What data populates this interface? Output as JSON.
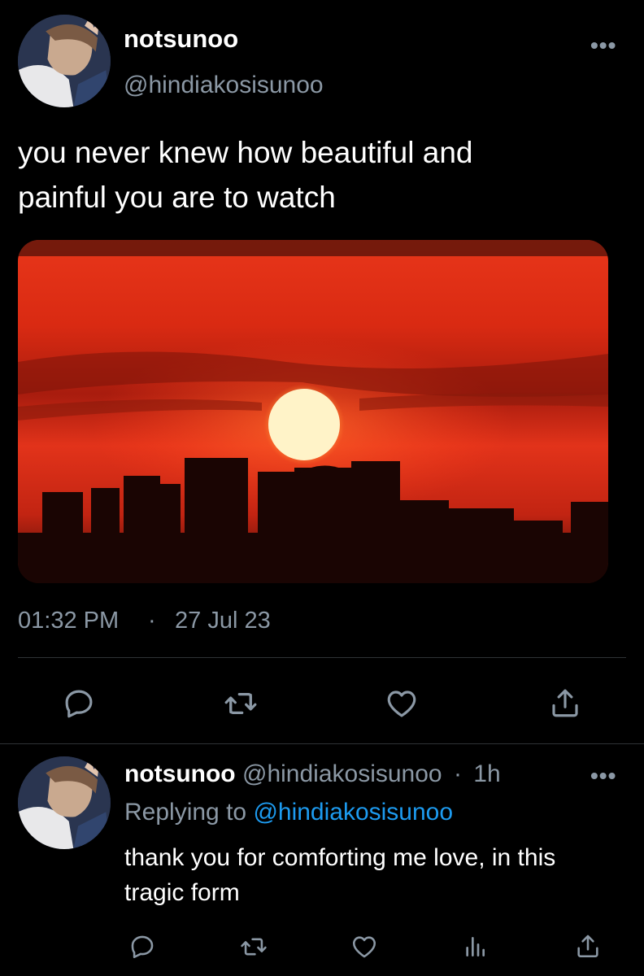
{
  "tweet": {
    "display_name": "notsunoo",
    "handle": "@hindiakosisunoo",
    "more_label": "•••",
    "text_line1": "you never knew how beautiful and",
    "text_line2": "painful you are to watch",
    "time": "01:32 PM",
    "separator": "·",
    "date": "27 Jul 23",
    "media_description": "sunset-photo"
  },
  "actions": {
    "reply_icon": "reply-icon",
    "retweet_icon": "retweet-icon",
    "like_icon": "heart-icon",
    "share_icon": "share-icon"
  },
  "reply": {
    "display_name": "notsunoo",
    "handle": "@hindiakosisunoo",
    "separator": "·",
    "age": "1h",
    "more_label": "•••",
    "replying_to_label": "Replying to",
    "replying_to_handle": "@hindiakosisunoo",
    "text_line1": "thank you for comforting me love, in this",
    "text_line2": "tragic form"
  },
  "colors": {
    "background": "#000000",
    "text": "#ffffff",
    "secondary": "#8b98a5",
    "link": "#1d9bf0",
    "divider": "#2f3336"
  }
}
